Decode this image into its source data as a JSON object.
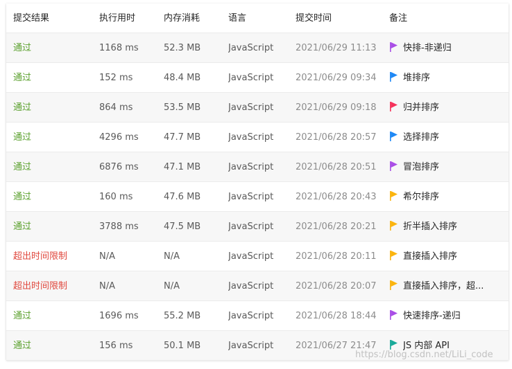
{
  "headers": {
    "status": "提交结果",
    "runtime": "执行用时",
    "memory": "内存消耗",
    "language": "语言",
    "submitted_at": "提交时间",
    "note": "备注"
  },
  "colors": {
    "accepted": "#5aa02c",
    "tle": "#e0483e",
    "purple": "#a94ee6",
    "blue": "#1e88f5",
    "red": "#f5325a",
    "yellow": "#fbb40d",
    "teal": "#18a999"
  },
  "rows": [
    {
      "status": "通过",
      "status_type": "ok",
      "runtime": "1168 ms",
      "memory": "52.3 MB",
      "language": "JavaScript",
      "date": "2021/06/29 11:13",
      "note": "快排-非递归",
      "flag": "purple-flag-icon",
      "flag_color": "purple"
    },
    {
      "status": "通过",
      "status_type": "ok",
      "runtime": "152 ms",
      "memory": "48.4 MB",
      "language": "JavaScript",
      "date": "2021/06/29 09:34",
      "note": "堆排序",
      "flag": "blue-flag-icon",
      "flag_color": "blue"
    },
    {
      "status": "通过",
      "status_type": "ok",
      "runtime": "864 ms",
      "memory": "53.5 MB",
      "language": "JavaScript",
      "date": "2021/06/29 09:18",
      "note": "归并排序",
      "flag": "red-flag-icon",
      "flag_color": "red"
    },
    {
      "status": "通过",
      "status_type": "ok",
      "runtime": "4296 ms",
      "memory": "47.7 MB",
      "language": "JavaScript",
      "date": "2021/06/28 20:57",
      "note": "选择排序",
      "flag": "blue-flag-icon",
      "flag_color": "blue"
    },
    {
      "status": "通过",
      "status_type": "ok",
      "runtime": "6876 ms",
      "memory": "47.1 MB",
      "language": "JavaScript",
      "date": "2021/06/28 20:51",
      "note": "冒泡排序",
      "flag": "purple-flag-icon",
      "flag_color": "purple"
    },
    {
      "status": "通过",
      "status_type": "ok",
      "runtime": "160 ms",
      "memory": "47.6 MB",
      "language": "JavaScript",
      "date": "2021/06/28 20:43",
      "note": "希尔排序",
      "flag": "yellow-flag-icon",
      "flag_color": "yellow"
    },
    {
      "status": "通过",
      "status_type": "ok",
      "runtime": "3788 ms",
      "memory": "47.5 MB",
      "language": "JavaScript",
      "date": "2021/06/28 20:21",
      "note": "折半插入排序",
      "flag": "yellow-flag-icon",
      "flag_color": "yellow"
    },
    {
      "status": "超出时间限制",
      "status_type": "tle",
      "runtime": "N/A",
      "memory": "N/A",
      "language": "JavaScript",
      "date": "2021/06/28 20:11",
      "note": "直接插入排序",
      "flag": "yellow-flag-icon",
      "flag_color": "yellow"
    },
    {
      "status": "超出时间限制",
      "status_type": "tle",
      "runtime": "N/A",
      "memory": "N/A",
      "language": "JavaScript",
      "date": "2021/06/28 20:07",
      "note": "直接插入排序，超...",
      "flag": "yellow-flag-icon",
      "flag_color": "yellow"
    },
    {
      "status": "通过",
      "status_type": "ok",
      "runtime": "1696 ms",
      "memory": "55.2 MB",
      "language": "JavaScript",
      "date": "2021/06/28 18:44",
      "note": "快速排序-递归",
      "flag": "purple-flag-icon",
      "flag_color": "purple"
    },
    {
      "status": "通过",
      "status_type": "ok",
      "runtime": "156 ms",
      "memory": "50.1 MB",
      "language": "JavaScript",
      "date": "2021/06/27 21:47",
      "note": "JS 内部 API",
      "flag": "teal-flag-icon",
      "flag_color": "teal"
    }
  ],
  "watermark": "https://blog.csdn.net/LiLi_code"
}
